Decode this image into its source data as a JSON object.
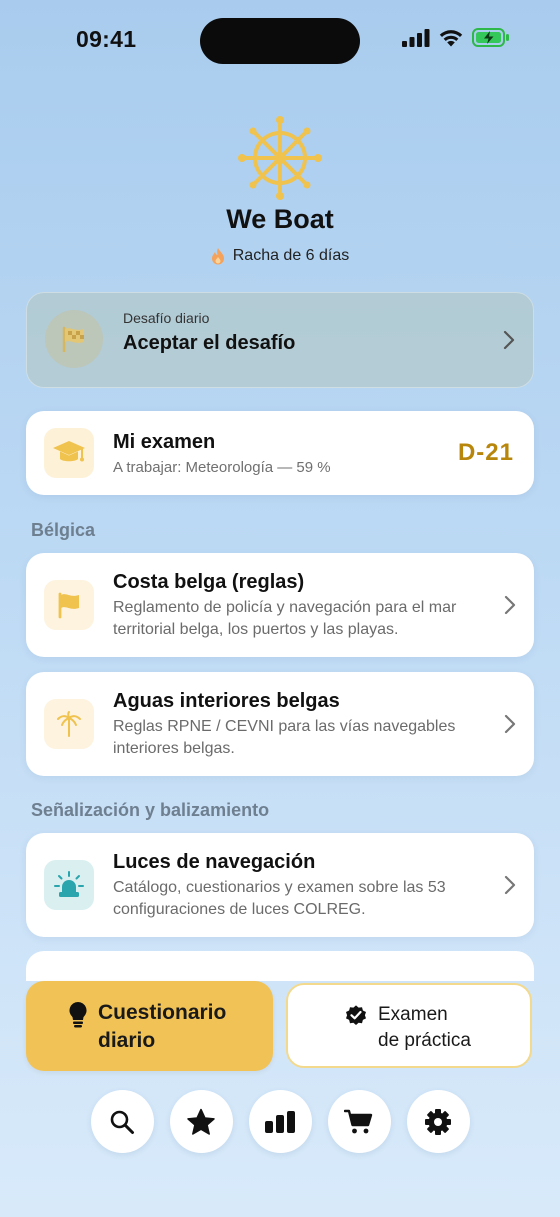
{
  "status_bar": {
    "time": "09:41"
  },
  "header": {
    "title": "We Boat",
    "streak": "Racha de 6 días"
  },
  "daily_challenge": {
    "kicker": "Desafío diario",
    "title": "Aceptar el desafío"
  },
  "my_exam": {
    "title": "Mi examen",
    "subtitle": "A trabajar: Meteorología — 59 %",
    "countdown": "D-21"
  },
  "sections": [
    {
      "label": "Bélgica",
      "items": [
        {
          "title": "Costa belga (reglas)",
          "description": "Reglamento de policía y navegación para el mar territorial belga, los puertos y las playas.",
          "icon": "flag-icon"
        },
        {
          "title": "Aguas interiores belgas",
          "description": "Reglas RPNE / CEVNI para las vías navegables interiores belgas.",
          "icon": "palm-tree-icon"
        }
      ]
    },
    {
      "label": "Señalización y balizamiento",
      "items": [
        {
          "title": "Luces de navegación",
          "description": "Catálogo, cuestionarios y examen sobre las 53 configuraciones de luces COLREG.",
          "icon": "beacon-light-icon"
        }
      ]
    }
  ],
  "actions": {
    "daily_quiz_line1": "Cuestionario",
    "daily_quiz_line2": "diario",
    "practice_exam_line1": "Examen",
    "practice_exam_line2": "de práctica"
  },
  "tabbar": [
    "search-icon",
    "star-icon",
    "bar-chart-icon",
    "cart-icon",
    "gear-icon"
  ],
  "colors": {
    "accent_gold": "#f1c356",
    "countdown": "#b8860b",
    "teal_tile": "#d9eff0"
  }
}
